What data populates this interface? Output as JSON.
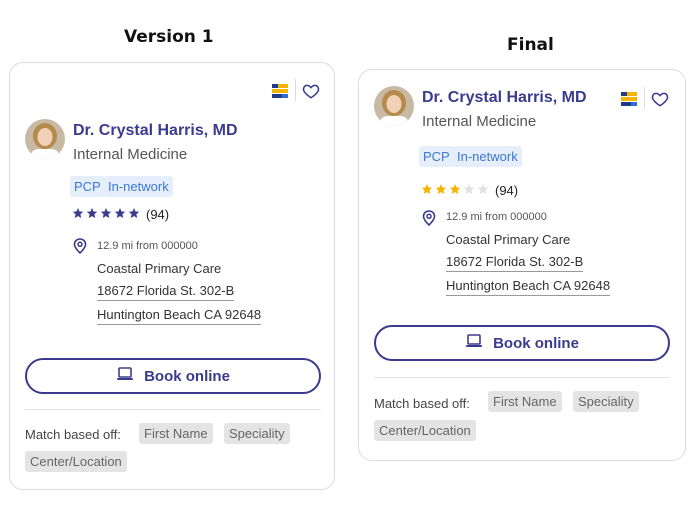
{
  "titles": {
    "v1": "Version 1",
    "final": "Final"
  },
  "cards": [
    {
      "name": "Dr. Crystal Harris, MD",
      "specialty": "Internal Medicine",
      "tags": [
        "PCP",
        "In-network"
      ],
      "rating": 5,
      "review_count": "(94)",
      "distance": "12.9 mi from 000000",
      "location": "Coastal Primary Care",
      "address_line1": "18672 Florida St. 302-B",
      "address_line2": "Huntington Beach CA 92648",
      "book_label": "Book online",
      "match_label": "Match based off:",
      "match_chips": [
        "First Name",
        "Speciality",
        "Center/Location"
      ],
      "star_color": "#3b3b8e"
    },
    {
      "name": "Dr. Crystal Harris, MD",
      "specialty": "Internal Medicine",
      "tags": [
        "PCP",
        "In-network"
      ],
      "rating": 3,
      "review_count": "(94)",
      "distance": "12.9 mi from 000000",
      "location": "Coastal Primary Care",
      "address_line1": "18672 Florida St. 302-B",
      "address_line2": "Huntington Beach CA 92648",
      "book_label": "Book online",
      "match_label": "Match based off:",
      "match_chips": [
        "First Name",
        "Speciality",
        "Center/Location"
      ],
      "star_color": "#f4b400"
    }
  ]
}
